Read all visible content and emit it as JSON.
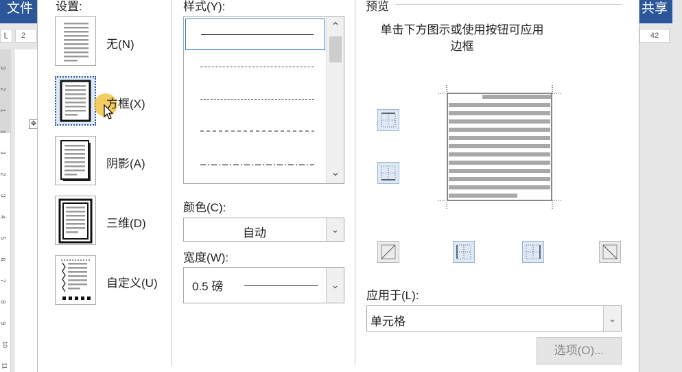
{
  "word": {
    "file_tab": "文件",
    "share_tab": "共享",
    "ruler_left_label": "2",
    "ruler_right_label": "42",
    "ruler_corner": "L",
    "vruler_ticks": [
      "3",
      "2",
      "1",
      "1",
      "1",
      "2",
      "3",
      "4",
      "5",
      "6",
      "7",
      "8",
      "9",
      "10",
      "11"
    ]
  },
  "dialog": {
    "settings": {
      "heading": "设置:",
      "items": [
        {
          "label": "无(N)",
          "icon": "border-none-icon"
        },
        {
          "label": "方框(X)",
          "icon": "border-box-icon",
          "selected": true
        },
        {
          "label": "阴影(A)",
          "icon": "border-shadow-icon"
        },
        {
          "label": "三维(D)",
          "icon": "border-3d-icon"
        },
        {
          "label": "自定义(U)",
          "icon": "border-custom-icon"
        }
      ]
    },
    "style": {
      "heading": "样式(Y):",
      "items": [
        "solid",
        "dotted",
        "dashed-small",
        "dashed",
        "dash-dot"
      ],
      "selected_index": 0
    },
    "color": {
      "label": "颜色(C):",
      "value": "自动"
    },
    "width": {
      "label": "宽度(W):",
      "value": "0.5 磅"
    },
    "preview": {
      "heading": "预览",
      "hint_line1": "单击下方图示或使用按钮可应用",
      "hint_line2": "边框"
    },
    "apply_to": {
      "label": "应用于(L):",
      "value": "单元格"
    },
    "options_button": "选项(O)..."
  },
  "colors": {
    "accent": "#2b579a",
    "selection_fill": "#dde9f7",
    "selection_border": "#2b79c2"
  }
}
